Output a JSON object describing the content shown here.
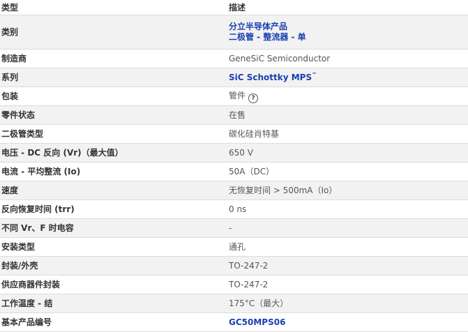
{
  "table": {
    "header": {
      "type_label": "类型",
      "desc_label": "描述"
    },
    "rows": [
      {
        "label": "类别",
        "links": [
          "分立半导体产品",
          "二极管 - 整流器 - 单"
        ]
      },
      {
        "label": "制造商",
        "value": "GeneSiC Semiconductor"
      },
      {
        "label": "系列",
        "link": "SiC Schottky MPS",
        "trademark": "™"
      },
      {
        "label": "包装",
        "value": "管件",
        "help_icon": "question-circle-icon",
        "help_glyph": "?"
      },
      {
        "label": "零件状态",
        "value": "在售"
      },
      {
        "label": "二极管类型",
        "value": "碳化硅肖特基"
      },
      {
        "label": "电压 - DC 反向 (Vr)（最大值）",
        "value": "650 V"
      },
      {
        "label": "电流 - 平均整流 (Io)",
        "value": "50A（DC）"
      },
      {
        "label": "速度",
        "value": "无恢复时间 > 500mA（Io）"
      },
      {
        "label": "反向恢复时间 (trr)",
        "value": "0 ns"
      },
      {
        "label": "不同 Vr、F 时电容",
        "value": "-"
      },
      {
        "label": "安装类型",
        "value": "通孔"
      },
      {
        "label": "封装/外壳",
        "value": "TO-247-2"
      },
      {
        "label": "供应商器件封装",
        "value": "TO-247-2"
      },
      {
        "label": "工作温度 - 结",
        "value": "175°C（最大）"
      },
      {
        "label": "基本产品编号",
        "link": "GC50MPS06"
      }
    ]
  },
  "colors": {
    "link": "#1a3fb0",
    "row_alt": "#f2f2f2",
    "border": "#dcdcdc"
  }
}
